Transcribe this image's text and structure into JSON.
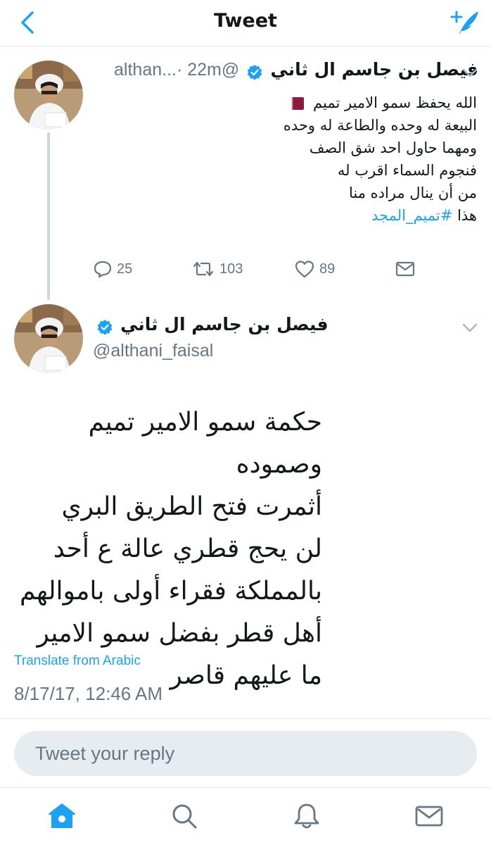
{
  "topbar": {
    "title": "Tweet",
    "back_icon": "chevron-left-icon",
    "compose_icon": "compose-tweet-icon"
  },
  "tweet1": {
    "name": "فيصل بن جاسم ال ثاني",
    "handle": "@althan...",
    "time": "· 22m",
    "body_line1": "الله يحفظ سمو الامير تميم",
    "body_line2": "البيعة له وحده والطاعة له وحده",
    "body_line3": "ومهما حاول احد شق الصف",
    "body_line4": "فنجوم السماء اقرب له",
    "body_line5": "من أن ينال مراده منا",
    "body_line6_prefix": "هذا",
    "hashtag": "#تميم_المجد",
    "replies": "25",
    "retweets": "103",
    "likes": "89"
  },
  "tweet2": {
    "name": "فيصل بن جاسم ال ثاني",
    "handle": "@althani_faisal",
    "lines": [
      "حكمة سمو الامير تميم وصموده",
      "أثمرت فتح الطريق البري",
      "لن يحج قطري عالة ع أحد",
      "بالمملكة فقراء أولى باموالهم",
      "أهل قطر بفضل سمو الامير",
      "ما عليهم قاصر"
    ],
    "translate": "Translate from Arabic",
    "timestamp": "8/17/17, 12:46 AM"
  },
  "reply": {
    "placeholder": "Tweet your reply"
  },
  "tabs": [
    "home-icon",
    "search-icon",
    "notifications-bell-icon",
    "messages-envelope-icon"
  ],
  "colors": {
    "accent": "#1da1f2",
    "secondary_text": "#657786",
    "divider": "#e1e8ed",
    "reply_bg": "#e6ecf0",
    "flag_maroon": "#8d1b3d"
  }
}
